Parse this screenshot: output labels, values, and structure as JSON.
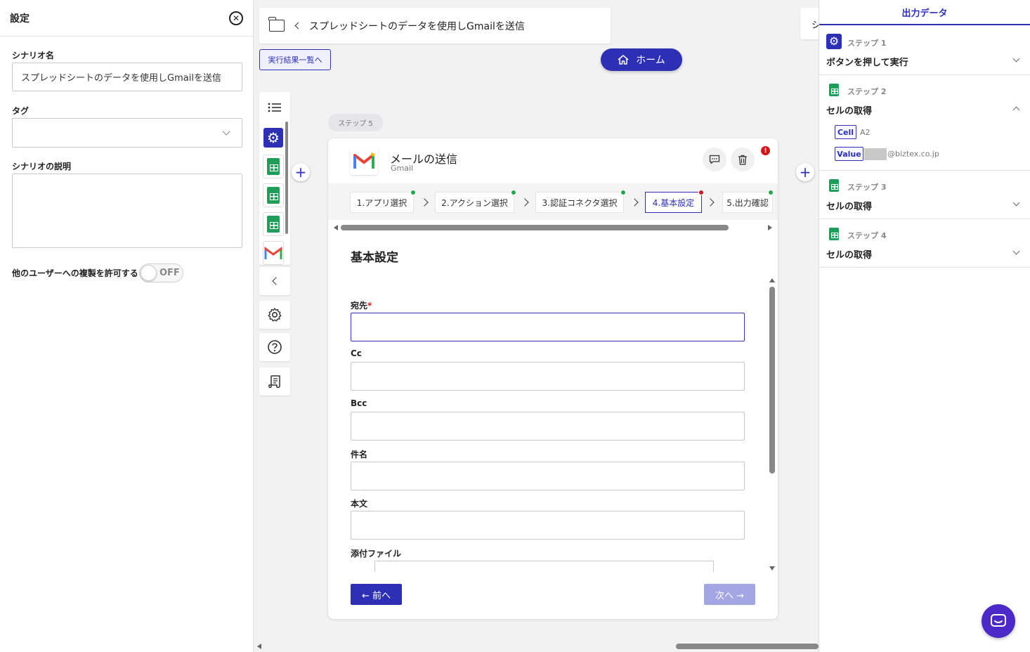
{
  "settings": {
    "title": "設定",
    "scenario_name_label": "シナリオ名",
    "scenario_name_value": "スプレッドシートのデータを使用しGmailを送信",
    "tag_label": "タグ",
    "tag_value": "",
    "description_label": "シナリオの説明",
    "description_value": "",
    "copy_permission_label": "他のユーザーへの複製を許可する",
    "copy_permission_state": "OFF"
  },
  "header": {
    "title": "スプレッドシートのデータを使用しGmailを送信",
    "results_button": "実行結果一覧へ",
    "home_button": "ホーム",
    "right_stub_text": "シ"
  },
  "step_chip": "ステップ 5",
  "card": {
    "title": "メールの送信",
    "subtitle": "Gmail",
    "error_badge": "!",
    "tabs": [
      {
        "label": "1.アプリ選択",
        "status": "done"
      },
      {
        "label": "2.アクション選択",
        "status": "done"
      },
      {
        "label": "3.認証コネクタ選択",
        "status": "done"
      },
      {
        "label": "4.基本設定",
        "status": "error"
      },
      {
        "label": "5.出力確認",
        "status": "done"
      }
    ],
    "section_title": "基本設定",
    "fields": [
      {
        "label": "宛先",
        "required": true,
        "value": ""
      },
      {
        "label": "Cc",
        "required": false,
        "value": ""
      },
      {
        "label": "Bcc",
        "required": false,
        "value": ""
      },
      {
        "label": "件名",
        "required": false,
        "value": ""
      },
      {
        "label": "本文",
        "required": false,
        "value": ""
      },
      {
        "label": "添付ファイル",
        "required": false,
        "value": ""
      }
    ],
    "required_mark": "*",
    "prev_button": "← 前へ",
    "next_button": "次へ →"
  },
  "output": {
    "title": "出力データ",
    "steps": [
      {
        "step": "ステップ 1",
        "name": "ボタンを押して実行",
        "icon": "gear-icon",
        "expanded": false
      },
      {
        "step": "ステップ 2",
        "name": "セルの取得",
        "icon": "sheets-icon",
        "expanded": true,
        "items": [
          {
            "key": "Cell",
            "value": "A2"
          },
          {
            "key": "Value",
            "value": "@biztex.co.jp"
          }
        ]
      },
      {
        "step": "ステップ 3",
        "name": "セルの取得",
        "icon": "sheets-icon",
        "expanded": false
      },
      {
        "step": "ステップ 4",
        "name": "セルの取得",
        "icon": "sheets-icon",
        "expanded": false
      }
    ]
  },
  "colors": {
    "accent": "#2d2fb5",
    "success": "#23a74b",
    "error": "#d01818",
    "sheets": "#1e9e58",
    "chat": "#4b2ac7"
  }
}
